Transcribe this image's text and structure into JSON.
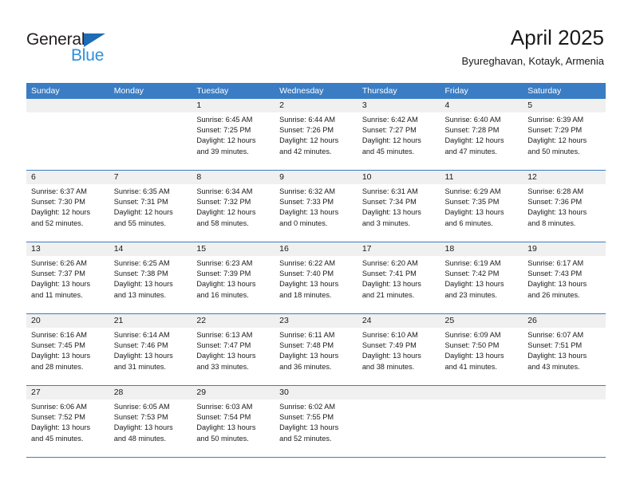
{
  "brand": {
    "name_dark": "General",
    "name_light": "Blue",
    "triangle_color": "#1f6bb5",
    "light_color": "#2d8fdd"
  },
  "header": {
    "title": "April 2025",
    "subtitle": "Byureghavan, Kotayk, Armenia"
  },
  "theme": {
    "header_blue": "#3b7dc4",
    "daynum_background": "#f0f0f0",
    "text_color": "#1a1a1a"
  },
  "weekday_headers": [
    "Sunday",
    "Monday",
    "Tuesday",
    "Wednesday",
    "Thursday",
    "Friday",
    "Saturday"
  ],
  "weeks": [
    [
      {
        "day": "",
        "sunrise": "",
        "sunset": "",
        "daylight_1": "",
        "daylight_2": ""
      },
      {
        "day": "",
        "sunrise": "",
        "sunset": "",
        "daylight_1": "",
        "daylight_2": ""
      },
      {
        "day": "1",
        "sunrise": "Sunrise: 6:45 AM",
        "sunset": "Sunset: 7:25 PM",
        "daylight_1": "Daylight: 12 hours",
        "daylight_2": "and 39 minutes."
      },
      {
        "day": "2",
        "sunrise": "Sunrise: 6:44 AM",
        "sunset": "Sunset: 7:26 PM",
        "daylight_1": "Daylight: 12 hours",
        "daylight_2": "and 42 minutes."
      },
      {
        "day": "3",
        "sunrise": "Sunrise: 6:42 AM",
        "sunset": "Sunset: 7:27 PM",
        "daylight_1": "Daylight: 12 hours",
        "daylight_2": "and 45 minutes."
      },
      {
        "day": "4",
        "sunrise": "Sunrise: 6:40 AM",
        "sunset": "Sunset: 7:28 PM",
        "daylight_1": "Daylight: 12 hours",
        "daylight_2": "and 47 minutes."
      },
      {
        "day": "5",
        "sunrise": "Sunrise: 6:39 AM",
        "sunset": "Sunset: 7:29 PM",
        "daylight_1": "Daylight: 12 hours",
        "daylight_2": "and 50 minutes."
      }
    ],
    [
      {
        "day": "6",
        "sunrise": "Sunrise: 6:37 AM",
        "sunset": "Sunset: 7:30 PM",
        "daylight_1": "Daylight: 12 hours",
        "daylight_2": "and 52 minutes."
      },
      {
        "day": "7",
        "sunrise": "Sunrise: 6:35 AM",
        "sunset": "Sunset: 7:31 PM",
        "daylight_1": "Daylight: 12 hours",
        "daylight_2": "and 55 minutes."
      },
      {
        "day": "8",
        "sunrise": "Sunrise: 6:34 AM",
        "sunset": "Sunset: 7:32 PM",
        "daylight_1": "Daylight: 12 hours",
        "daylight_2": "and 58 minutes."
      },
      {
        "day": "9",
        "sunrise": "Sunrise: 6:32 AM",
        "sunset": "Sunset: 7:33 PM",
        "daylight_1": "Daylight: 13 hours",
        "daylight_2": "and 0 minutes."
      },
      {
        "day": "10",
        "sunrise": "Sunrise: 6:31 AM",
        "sunset": "Sunset: 7:34 PM",
        "daylight_1": "Daylight: 13 hours",
        "daylight_2": "and 3 minutes."
      },
      {
        "day": "11",
        "sunrise": "Sunrise: 6:29 AM",
        "sunset": "Sunset: 7:35 PM",
        "daylight_1": "Daylight: 13 hours",
        "daylight_2": "and 6 minutes."
      },
      {
        "day": "12",
        "sunrise": "Sunrise: 6:28 AM",
        "sunset": "Sunset: 7:36 PM",
        "daylight_1": "Daylight: 13 hours",
        "daylight_2": "and 8 minutes."
      }
    ],
    [
      {
        "day": "13",
        "sunrise": "Sunrise: 6:26 AM",
        "sunset": "Sunset: 7:37 PM",
        "daylight_1": "Daylight: 13 hours",
        "daylight_2": "and 11 minutes."
      },
      {
        "day": "14",
        "sunrise": "Sunrise: 6:25 AM",
        "sunset": "Sunset: 7:38 PM",
        "daylight_1": "Daylight: 13 hours",
        "daylight_2": "and 13 minutes."
      },
      {
        "day": "15",
        "sunrise": "Sunrise: 6:23 AM",
        "sunset": "Sunset: 7:39 PM",
        "daylight_1": "Daylight: 13 hours",
        "daylight_2": "and 16 minutes."
      },
      {
        "day": "16",
        "sunrise": "Sunrise: 6:22 AM",
        "sunset": "Sunset: 7:40 PM",
        "daylight_1": "Daylight: 13 hours",
        "daylight_2": "and 18 minutes."
      },
      {
        "day": "17",
        "sunrise": "Sunrise: 6:20 AM",
        "sunset": "Sunset: 7:41 PM",
        "daylight_1": "Daylight: 13 hours",
        "daylight_2": "and 21 minutes."
      },
      {
        "day": "18",
        "sunrise": "Sunrise: 6:19 AM",
        "sunset": "Sunset: 7:42 PM",
        "daylight_1": "Daylight: 13 hours",
        "daylight_2": "and 23 minutes."
      },
      {
        "day": "19",
        "sunrise": "Sunrise: 6:17 AM",
        "sunset": "Sunset: 7:43 PM",
        "daylight_1": "Daylight: 13 hours",
        "daylight_2": "and 26 minutes."
      }
    ],
    [
      {
        "day": "20",
        "sunrise": "Sunrise: 6:16 AM",
        "sunset": "Sunset: 7:45 PM",
        "daylight_1": "Daylight: 13 hours",
        "daylight_2": "and 28 minutes."
      },
      {
        "day": "21",
        "sunrise": "Sunrise: 6:14 AM",
        "sunset": "Sunset: 7:46 PM",
        "daylight_1": "Daylight: 13 hours",
        "daylight_2": "and 31 minutes."
      },
      {
        "day": "22",
        "sunrise": "Sunrise: 6:13 AM",
        "sunset": "Sunset: 7:47 PM",
        "daylight_1": "Daylight: 13 hours",
        "daylight_2": "and 33 minutes."
      },
      {
        "day": "23",
        "sunrise": "Sunrise: 6:11 AM",
        "sunset": "Sunset: 7:48 PM",
        "daylight_1": "Daylight: 13 hours",
        "daylight_2": "and 36 minutes."
      },
      {
        "day": "24",
        "sunrise": "Sunrise: 6:10 AM",
        "sunset": "Sunset: 7:49 PM",
        "daylight_1": "Daylight: 13 hours",
        "daylight_2": "and 38 minutes."
      },
      {
        "day": "25",
        "sunrise": "Sunrise: 6:09 AM",
        "sunset": "Sunset: 7:50 PM",
        "daylight_1": "Daylight: 13 hours",
        "daylight_2": "and 41 minutes."
      },
      {
        "day": "26",
        "sunrise": "Sunrise: 6:07 AM",
        "sunset": "Sunset: 7:51 PM",
        "daylight_1": "Daylight: 13 hours",
        "daylight_2": "and 43 minutes."
      }
    ],
    [
      {
        "day": "27",
        "sunrise": "Sunrise: 6:06 AM",
        "sunset": "Sunset: 7:52 PM",
        "daylight_1": "Daylight: 13 hours",
        "daylight_2": "and 45 minutes."
      },
      {
        "day": "28",
        "sunrise": "Sunrise: 6:05 AM",
        "sunset": "Sunset: 7:53 PM",
        "daylight_1": "Daylight: 13 hours",
        "daylight_2": "and 48 minutes."
      },
      {
        "day": "29",
        "sunrise": "Sunrise: 6:03 AM",
        "sunset": "Sunset: 7:54 PM",
        "daylight_1": "Daylight: 13 hours",
        "daylight_2": "and 50 minutes."
      },
      {
        "day": "30",
        "sunrise": "Sunrise: 6:02 AM",
        "sunset": "Sunset: 7:55 PM",
        "daylight_1": "Daylight: 13 hours",
        "daylight_2": "and 52 minutes."
      },
      {
        "day": "",
        "sunrise": "",
        "sunset": "",
        "daylight_1": "",
        "daylight_2": ""
      },
      {
        "day": "",
        "sunrise": "",
        "sunset": "",
        "daylight_1": "",
        "daylight_2": ""
      },
      {
        "day": "",
        "sunrise": "",
        "sunset": "",
        "daylight_1": "",
        "daylight_2": ""
      }
    ]
  ]
}
